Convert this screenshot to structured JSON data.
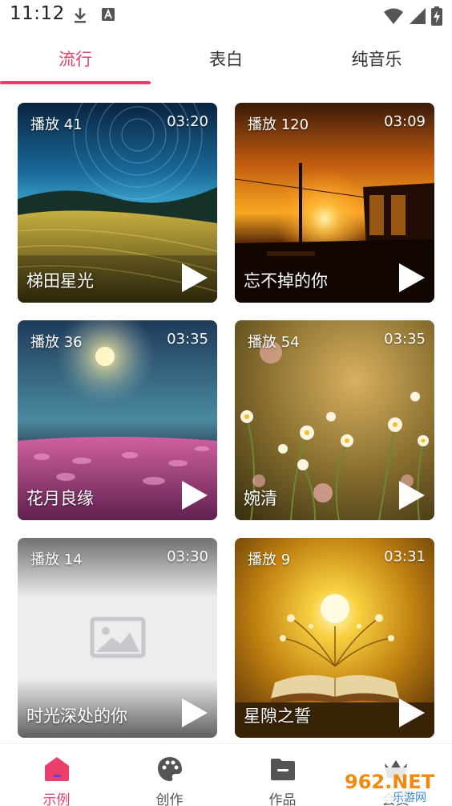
{
  "status_bar": {
    "time": "11:12"
  },
  "tabs": [
    {
      "label": "流行",
      "active": true
    },
    {
      "label": "表白",
      "active": false
    },
    {
      "label": "纯音乐",
      "active": false
    }
  ],
  "cards": [
    {
      "plays": "播放 41",
      "duration": "03:20",
      "title": "梯田星光",
      "image": "night-terraces"
    },
    {
      "plays": "播放 120",
      "duration": "03:09",
      "title": "忘不掉的你",
      "image": "sunset-cabin"
    },
    {
      "plays": "播放 36",
      "duration": "03:35",
      "title": "花月良缘",
      "image": "moon-flower-field"
    },
    {
      "plays": "播放 54",
      "duration": "03:35",
      "title": "婉清",
      "image": "daisies"
    },
    {
      "plays": "播放 14",
      "duration": "03:30",
      "title": "时光深处的你",
      "image": "image-placeholder"
    },
    {
      "plays": "播放 9",
      "duration": "03:31",
      "title": "星隙之誓",
      "image": "glowing-book"
    }
  ],
  "bottom_nav": [
    {
      "label": "示例",
      "icon": "home-icon",
      "active": true
    },
    {
      "label": "创作",
      "icon": "palette-icon",
      "active": false
    },
    {
      "label": "作品",
      "icon": "folder-icon",
      "active": false
    },
    {
      "label": "会员",
      "icon": "crown-icon",
      "active": false
    }
  ],
  "watermark": {
    "text_top": "962.NET",
    "text_bottom": "乐游网"
  },
  "colors": {
    "accent": "#ea3f6b",
    "text": "#333333"
  }
}
